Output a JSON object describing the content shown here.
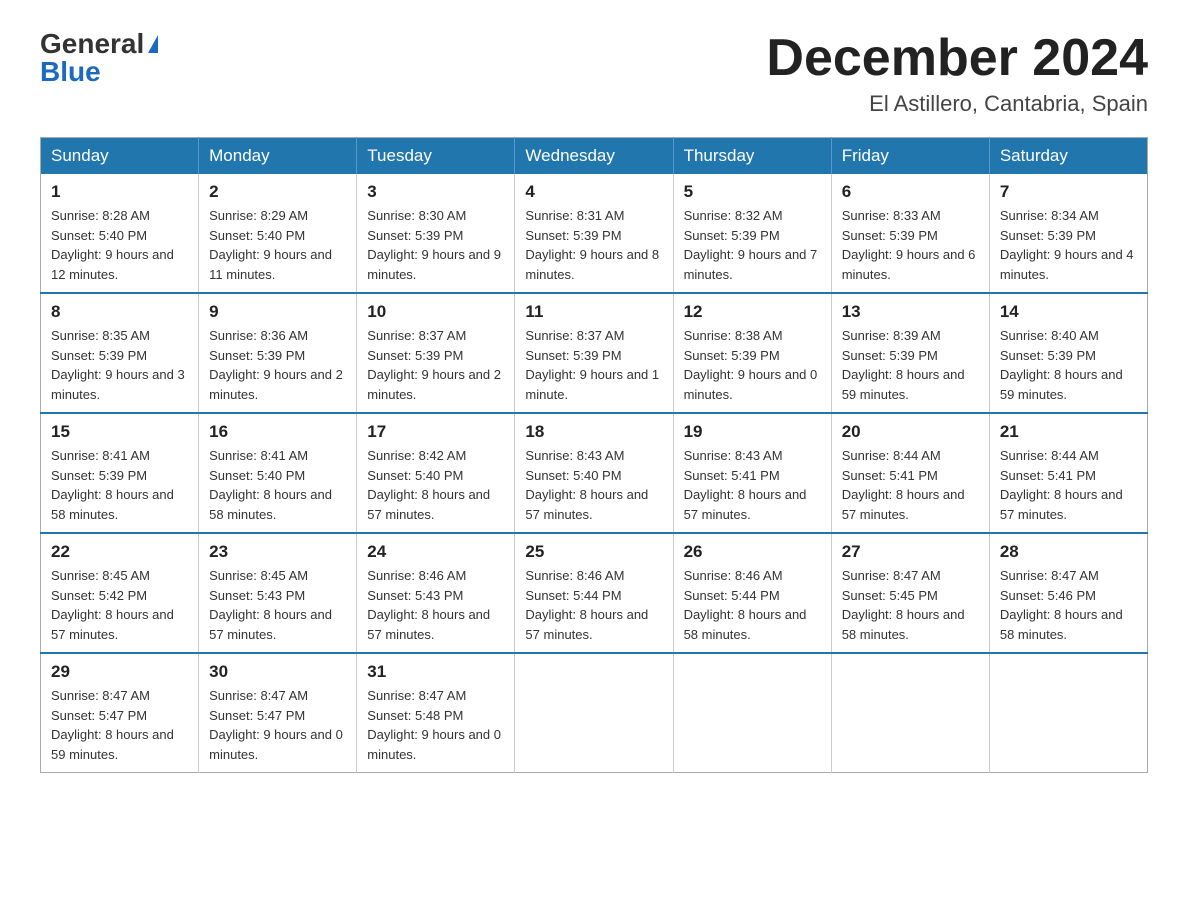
{
  "header": {
    "logo_general": "General",
    "logo_blue": "Blue",
    "month_title": "December 2024",
    "location": "El Astillero, Cantabria, Spain"
  },
  "weekdays": [
    "Sunday",
    "Monday",
    "Tuesday",
    "Wednesday",
    "Thursday",
    "Friday",
    "Saturday"
  ],
  "weeks": [
    [
      {
        "day": "1",
        "sunrise": "8:28 AM",
        "sunset": "5:40 PM",
        "daylight": "9 hours and 12 minutes."
      },
      {
        "day": "2",
        "sunrise": "8:29 AM",
        "sunset": "5:40 PM",
        "daylight": "9 hours and 11 minutes."
      },
      {
        "day": "3",
        "sunrise": "8:30 AM",
        "sunset": "5:39 PM",
        "daylight": "9 hours and 9 minutes."
      },
      {
        "day": "4",
        "sunrise": "8:31 AM",
        "sunset": "5:39 PM",
        "daylight": "9 hours and 8 minutes."
      },
      {
        "day": "5",
        "sunrise": "8:32 AM",
        "sunset": "5:39 PM",
        "daylight": "9 hours and 7 minutes."
      },
      {
        "day": "6",
        "sunrise": "8:33 AM",
        "sunset": "5:39 PM",
        "daylight": "9 hours and 6 minutes."
      },
      {
        "day": "7",
        "sunrise": "8:34 AM",
        "sunset": "5:39 PM",
        "daylight": "9 hours and 4 minutes."
      }
    ],
    [
      {
        "day": "8",
        "sunrise": "8:35 AM",
        "sunset": "5:39 PM",
        "daylight": "9 hours and 3 minutes."
      },
      {
        "day": "9",
        "sunrise": "8:36 AM",
        "sunset": "5:39 PM",
        "daylight": "9 hours and 2 minutes."
      },
      {
        "day": "10",
        "sunrise": "8:37 AM",
        "sunset": "5:39 PM",
        "daylight": "9 hours and 2 minutes."
      },
      {
        "day": "11",
        "sunrise": "8:37 AM",
        "sunset": "5:39 PM",
        "daylight": "9 hours and 1 minute."
      },
      {
        "day": "12",
        "sunrise": "8:38 AM",
        "sunset": "5:39 PM",
        "daylight": "9 hours and 0 minutes."
      },
      {
        "day": "13",
        "sunrise": "8:39 AM",
        "sunset": "5:39 PM",
        "daylight": "8 hours and 59 minutes."
      },
      {
        "day": "14",
        "sunrise": "8:40 AM",
        "sunset": "5:39 PM",
        "daylight": "8 hours and 59 minutes."
      }
    ],
    [
      {
        "day": "15",
        "sunrise": "8:41 AM",
        "sunset": "5:39 PM",
        "daylight": "8 hours and 58 minutes."
      },
      {
        "day": "16",
        "sunrise": "8:41 AM",
        "sunset": "5:40 PM",
        "daylight": "8 hours and 58 minutes."
      },
      {
        "day": "17",
        "sunrise": "8:42 AM",
        "sunset": "5:40 PM",
        "daylight": "8 hours and 57 minutes."
      },
      {
        "day": "18",
        "sunrise": "8:43 AM",
        "sunset": "5:40 PM",
        "daylight": "8 hours and 57 minutes."
      },
      {
        "day": "19",
        "sunrise": "8:43 AM",
        "sunset": "5:41 PM",
        "daylight": "8 hours and 57 minutes."
      },
      {
        "day": "20",
        "sunrise": "8:44 AM",
        "sunset": "5:41 PM",
        "daylight": "8 hours and 57 minutes."
      },
      {
        "day": "21",
        "sunrise": "8:44 AM",
        "sunset": "5:41 PM",
        "daylight": "8 hours and 57 minutes."
      }
    ],
    [
      {
        "day": "22",
        "sunrise": "8:45 AM",
        "sunset": "5:42 PM",
        "daylight": "8 hours and 57 minutes."
      },
      {
        "day": "23",
        "sunrise": "8:45 AM",
        "sunset": "5:43 PM",
        "daylight": "8 hours and 57 minutes."
      },
      {
        "day": "24",
        "sunrise": "8:46 AM",
        "sunset": "5:43 PM",
        "daylight": "8 hours and 57 minutes."
      },
      {
        "day": "25",
        "sunrise": "8:46 AM",
        "sunset": "5:44 PM",
        "daylight": "8 hours and 57 minutes."
      },
      {
        "day": "26",
        "sunrise": "8:46 AM",
        "sunset": "5:44 PM",
        "daylight": "8 hours and 58 minutes."
      },
      {
        "day": "27",
        "sunrise": "8:47 AM",
        "sunset": "5:45 PM",
        "daylight": "8 hours and 58 minutes."
      },
      {
        "day": "28",
        "sunrise": "8:47 AM",
        "sunset": "5:46 PM",
        "daylight": "8 hours and 58 minutes."
      }
    ],
    [
      {
        "day": "29",
        "sunrise": "8:47 AM",
        "sunset": "5:47 PM",
        "daylight": "8 hours and 59 minutes."
      },
      {
        "day": "30",
        "sunrise": "8:47 AM",
        "sunset": "5:47 PM",
        "daylight": "9 hours and 0 minutes."
      },
      {
        "day": "31",
        "sunrise": "8:47 AM",
        "sunset": "5:48 PM",
        "daylight": "9 hours and 0 minutes."
      },
      null,
      null,
      null,
      null
    ]
  ]
}
